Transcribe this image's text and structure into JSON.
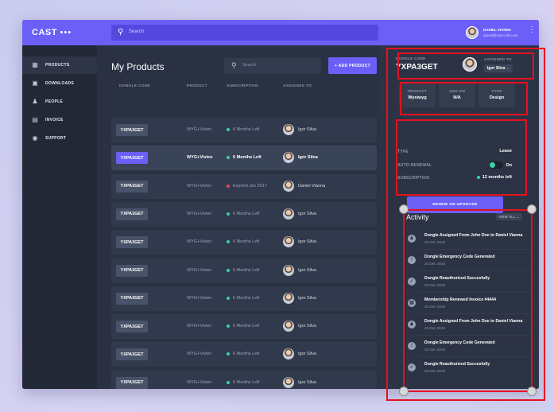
{
  "header": {
    "logo": "CAST",
    "logo_mark": "&#8226;&#8226;",
    "search_placeholder": "Search",
    "user_name": "DANIEL VIANNA",
    "user_email": "daniel@cast-soft.com"
  },
  "sidebar": {
    "items": [
      {
        "label": "PRODUCTS",
        "icon": "grid-icon"
      },
      {
        "label": "DOWNLOADS",
        "icon": "download-icon"
      },
      {
        "label": "PEOPLE",
        "icon": "people-icon"
      },
      {
        "label": "INVOICE",
        "icon": "invoice-icon"
      },
      {
        "label": "SUPPORT",
        "icon": "globe-icon"
      }
    ]
  },
  "main": {
    "title": "My Products",
    "search_placeholder": "Search",
    "add_button": "+ ADD PRODUCT",
    "columns": [
      "DONGLE CODE",
      "PRODUCT",
      "SUBSCRIPTION",
      "ASSIGNED TO"
    ],
    "rows": [
      {
        "code": "YXPA3GET",
        "product": "WYG+Vivien",
        "subscription": "6 Months Left",
        "status": "ok",
        "assigned": "Igor Silva"
      },
      {
        "code": "YXPA3GET",
        "product": "WYG+Vivien",
        "subscription": "6 Months Left",
        "status": "ok",
        "assigned": "Igor Silva",
        "selected": true
      },
      {
        "code": "YXPA3GET",
        "product": "WYG+Vivien",
        "subscription": "Expired Jan 2017",
        "status": "expired",
        "assigned": "Daniel Vianna"
      },
      {
        "code": "YXPA3GET",
        "product": "WYG+Vivien",
        "subscription": "6 Months Left",
        "status": "ok",
        "assigned": "Igor Silva"
      },
      {
        "code": "YXPA3GET",
        "product": "WYG+Vivien",
        "subscription": "6 Months Left",
        "status": "ok",
        "assigned": "Igor Silva"
      },
      {
        "code": "YXPA3GET",
        "product": "WYG+Vivien",
        "subscription": "6 Months Left",
        "status": "ok",
        "assigned": "Igor Silva"
      },
      {
        "code": "YXPA3GET",
        "product": "WYG+Vivien",
        "subscription": "6 Months Left",
        "status": "ok",
        "assigned": "Igor Silva"
      },
      {
        "code": "YXPA3GET",
        "product": "WYG+Vivien",
        "subscription": "6 Months Left",
        "status": "ok",
        "assigned": "Igor Silva"
      },
      {
        "code": "YXPA3GET",
        "product": "WYG+Vivien",
        "subscription": "6 Months Left",
        "status": "ok",
        "assigned": "Igor Silva"
      },
      {
        "code": "YXPA3GET",
        "product": "WYG+Vivien",
        "subscription": "6 Months Left",
        "status": "ok",
        "assigned": "Igor Silva"
      }
    ]
  },
  "detail": {
    "dongle_label": "DONGLE CODE",
    "dongle_code": "YXPA3GET",
    "assigned_label": "ASSIGNED TO",
    "assigned_name": "Igor Silva",
    "cards": [
      {
        "label": "PRODUCT",
        "value": "Wysiwyg"
      },
      {
        "label": "ADD-ON",
        "value": "N/A"
      },
      {
        "label": "TYPE",
        "value": "Design"
      }
    ],
    "type_label": "TYPE",
    "type_value": "Lease",
    "renewal_label": "AUTO-RENEWAL",
    "renewal_value": "On",
    "subscription_label": "SUBSCRIPTION",
    "subscription_value": "12 months left",
    "renew_button": "RENEW OR UPGRADE"
  },
  "activity": {
    "title": "Activity",
    "view_all": "VIEW ALL",
    "items": [
      {
        "text": "Dongle Assigned From John Doe to Daniel Vianna",
        "date": "20 Dec 2016",
        "icon": "person-icon"
      },
      {
        "text": "Dongle Emergency Code Generated",
        "date": "20 Dec 2016",
        "icon": "alert-icon"
      },
      {
        "text": "Dongle Reauthorized Succesfully",
        "date": "20 Dec 2016",
        "icon": "check-icon"
      },
      {
        "text": "Membership Renewed Invoice #4444",
        "date": "20 Dec 2016",
        "icon": "invoice-icon"
      },
      {
        "text": "Dongle Assigned From John Doe to Daniel Vianna",
        "date": "20 Dec 2016",
        "icon": "person-icon"
      },
      {
        "text": "Dongle Emergency Code Generated",
        "date": "20 Dec 2016",
        "icon": "alert-icon"
      },
      {
        "text": "Dongle Reauthorized Succesfully",
        "date": "20 Dec 2016",
        "icon": "check-icon"
      }
    ]
  },
  "colors": {
    "accent": "#6b5ff7",
    "ok": "#3ad2a0",
    "expired": "#f0435a",
    "annotation": "#e8101e"
  }
}
